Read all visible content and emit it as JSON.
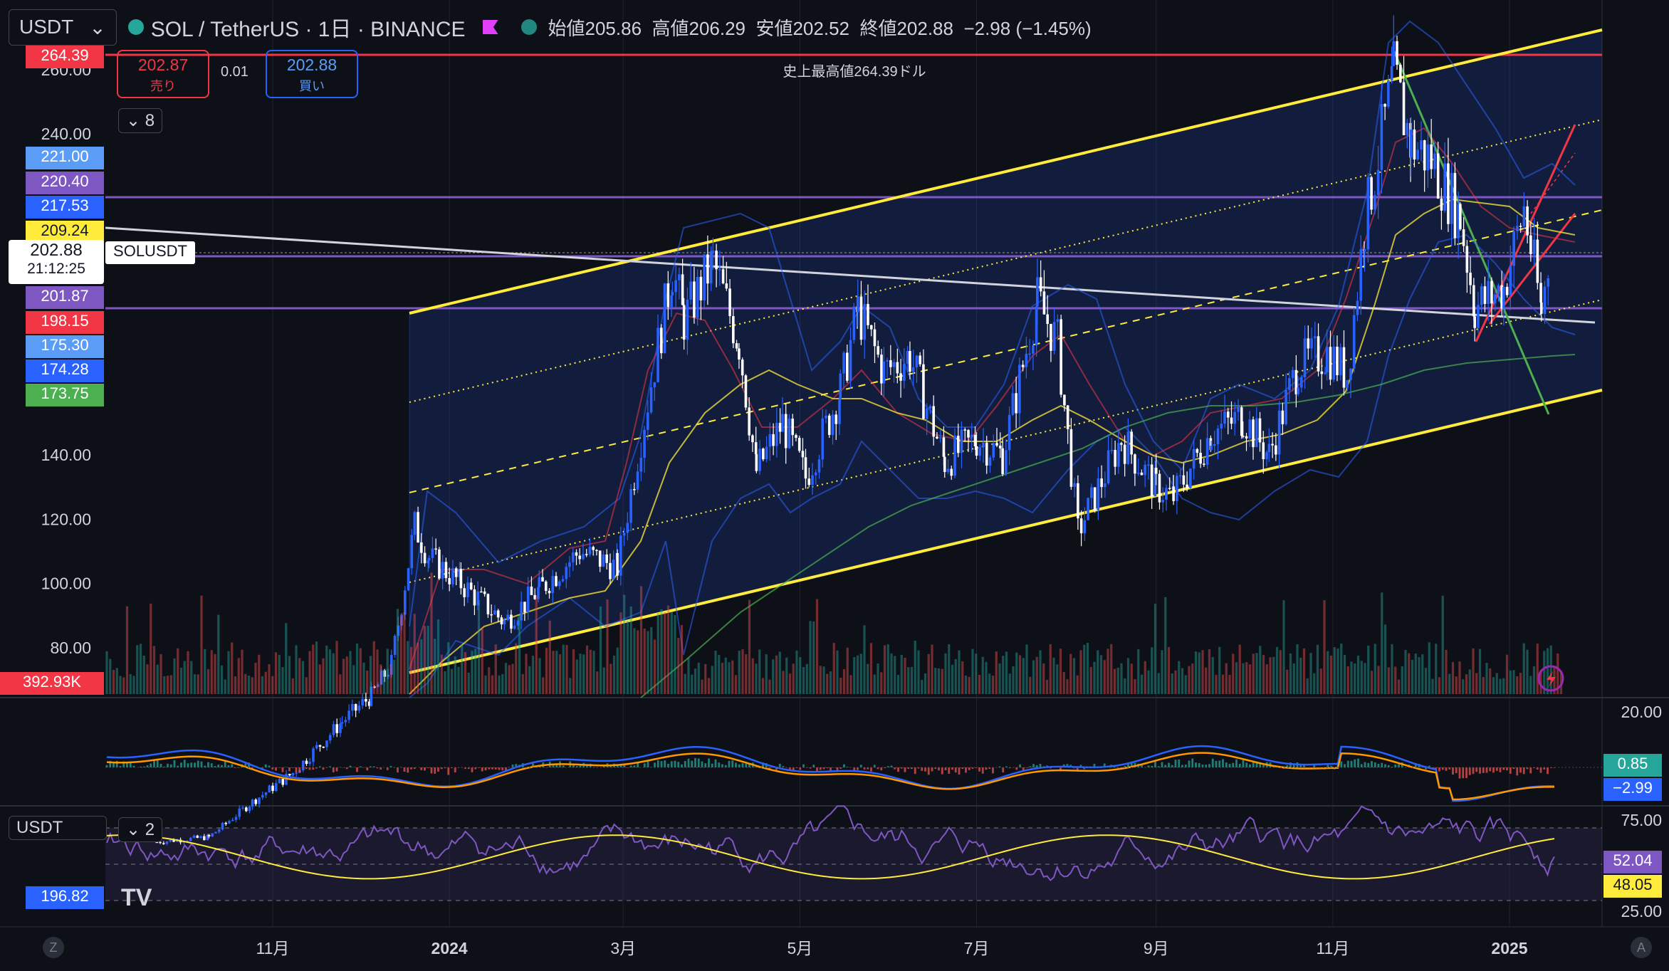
{
  "header": {
    "currency": "USDT",
    "symbol": "SOL / TetherUS · 1日 · BINANCE",
    "ohlc": {
      "open": "始値205.86",
      "high": "高値206.29",
      "low": "安値202.52",
      "close": "終値202.88",
      "change": "−2.98 (−1.45%)"
    }
  },
  "trade": {
    "sell_price": "202.87",
    "sell_label": "売り",
    "spread": "0.01",
    "buy_price": "202.88",
    "buy_label": "買い"
  },
  "indicator_toggle_main": "8",
  "indicator_toggle_rsi": "2",
  "ath_label": "史上最高値264.39ドル",
  "volume_badge": "392.93K",
  "current": {
    "price": "202.88",
    "symbol_tag": "SOLUSDT",
    "countdown": "21:12:25"
  },
  "rsi_pane_currency": "USDT",
  "rsi_left_badge": "196.82",
  "price_badges": [
    {
      "value": "264.39",
      "color": "#f23645"
    },
    {
      "value": "221.00",
      "color": "#5b9cf6"
    },
    {
      "value": "220.40",
      "color": "#7e57c2"
    },
    {
      "value": "217.53",
      "color": "#2962ff"
    },
    {
      "value": "209.24",
      "color": "#ffeb3b"
    },
    {
      "value": "201.87",
      "color": "#7e57c2"
    },
    {
      "value": "198.15",
      "color": "#f23645"
    },
    {
      "value": "175.30",
      "color": "#5b9cf6"
    },
    {
      "value": "174.28",
      "color": "#2962ff"
    },
    {
      "value": "173.75",
      "color": "#4caf50"
    }
  ],
  "macd_badges": [
    {
      "value": "0.85",
      "color": "#26a69a"
    },
    {
      "value": "−2.99",
      "color": "#2962ff"
    }
  ],
  "rsi_badges": [
    {
      "value": "52.04",
      "color": "#7e57c2"
    },
    {
      "value": "48.05",
      "color": "#ffeb3b"
    }
  ],
  "bottom_left": "Z",
  "bottom_right": "A",
  "chart_data": {
    "type": "candlestick",
    "title": "SOL / TetherUS · 1日 · BINANCE",
    "y_ticks": [
      "260.00",
      "240.00",
      "140.00",
      "120.00",
      "100.00",
      "80.00"
    ],
    "x_ticks": [
      "11月",
      "2024",
      "3月",
      "5月",
      "7月",
      "9月",
      "11月",
      "2025"
    ],
    "macd_ticks": [
      "20.00"
    ],
    "rsi_ticks": [
      "75.00",
      "25.00"
    ],
    "ylim": [
      58,
      272
    ],
    "horizontal_levels": [
      {
        "value": 264.39,
        "color": "#f23645"
      },
      {
        "value": 220.4,
        "color": "#7e57c2"
      },
      {
        "value": 202.0,
        "color": "#7e57c2"
      },
      {
        "value": 186.0,
        "color": "#7e57c2"
      }
    ],
    "price_path": [
      [
        "2023-09-22",
        19.5
      ],
      [
        "2023-10-10",
        21
      ],
      [
        "2023-10-25",
        32
      ],
      [
        "2023-11-08",
        41
      ],
      [
        "2023-11-25",
        57
      ],
      [
        "2023-12-05",
        65
      ],
      [
        "2023-12-12",
        75
      ],
      [
        "2023-12-20",
        118
      ],
      [
        "2023-12-25",
        108
      ],
      [
        "2024-01-05",
        100
      ],
      [
        "2024-01-20",
        88
      ],
      [
        "2024-02-01",
        98
      ],
      [
        "2024-02-15",
        110
      ],
      [
        "2024-02-28",
        105
      ],
      [
        "2024-03-06",
        140
      ],
      [
        "2024-03-18",
        198
      ],
      [
        "2024-03-22",
        182
      ],
      [
        "2024-04-01",
        200
      ],
      [
        "2024-04-10",
        175
      ],
      [
        "2024-04-16",
        135
      ],
      [
        "2024-04-25",
        150
      ],
      [
        "2024-05-03",
        133
      ],
      [
        "2024-05-15",
        160
      ],
      [
        "2024-05-21",
        185
      ],
      [
        "2024-05-30",
        166
      ],
      [
        "2024-06-08",
        171
      ],
      [
        "2024-06-20",
        138
      ],
      [
        "2024-07-01",
        145
      ],
      [
        "2024-07-10",
        140
      ],
      [
        "2024-07-22",
        188
      ],
      [
        "2024-07-29",
        175
      ],
      [
        "2024-08-05",
        116
      ],
      [
        "2024-08-20",
        145
      ],
      [
        "2024-09-01",
        130
      ],
      [
        "2024-09-07",
        127
      ],
      [
        "2024-09-20",
        147
      ],
      [
        "2024-10-01",
        152
      ],
      [
        "2024-10-10",
        140
      ],
      [
        "2024-10-20",
        168
      ],
      [
        "2024-10-30",
        172
      ],
      [
        "2024-11-06",
        165
      ],
      [
        "2024-11-12",
        212
      ],
      [
        "2024-11-22",
        258
      ],
      [
        "2024-11-28",
        237
      ],
      [
        "2024-12-05",
        232
      ],
      [
        "2024-12-15",
        214
      ],
      [
        "2024-12-20",
        186
      ],
      [
        "2024-12-30",
        192
      ],
      [
        "2025-01-06",
        217
      ],
      [
        "2025-01-12",
        185
      ],
      [
        "2025-01-15",
        202.88
      ]
    ]
  }
}
